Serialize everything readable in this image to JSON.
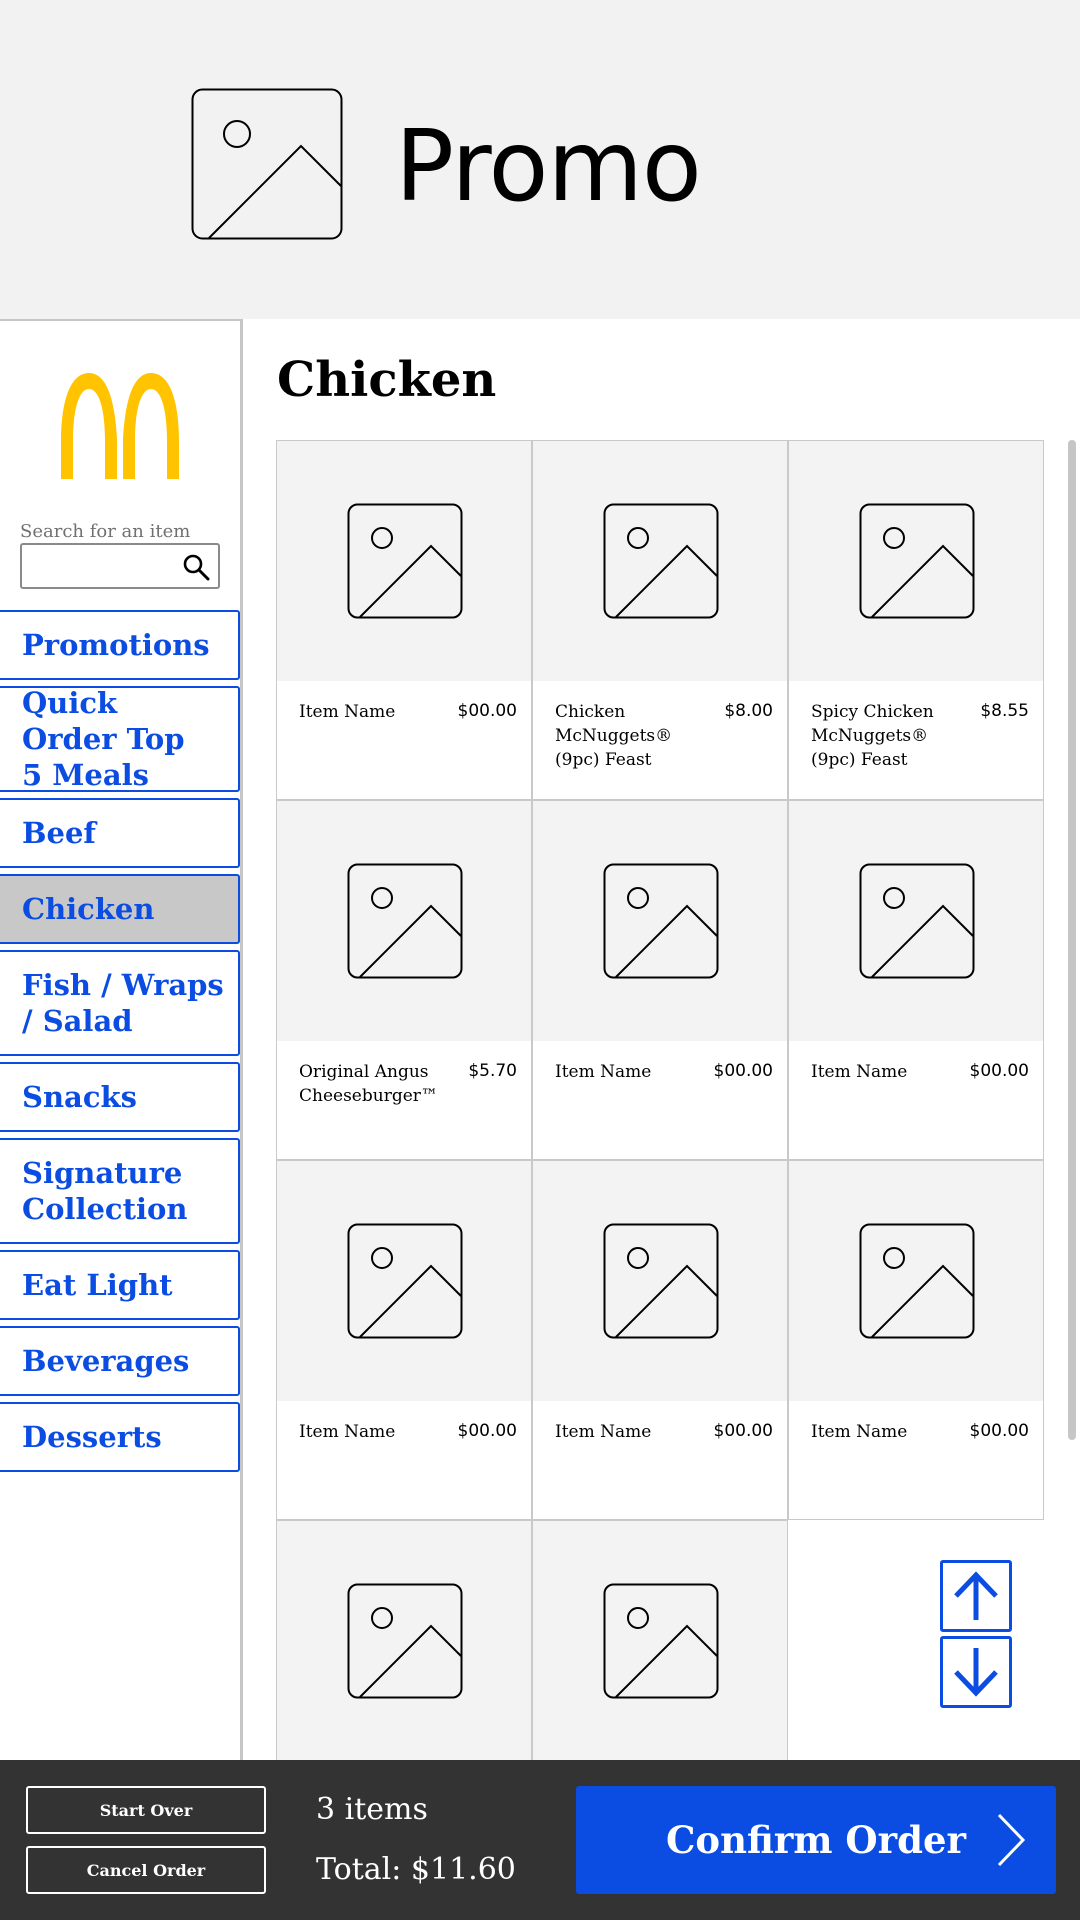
{
  "promo": {
    "title": "Promo",
    "image_icon": "image-placeholder-icon"
  },
  "sidebar": {
    "logo_icon": "mcdonalds-arches-logo",
    "search": {
      "label": "Search for an item",
      "placeholder": "",
      "value": "",
      "icon": "search-icon"
    },
    "categories": [
      {
        "label": "Promotions",
        "active": false
      },
      {
        "label": "Quick Order Top 5 Meals",
        "active": false
      },
      {
        "label": "Beef",
        "active": false
      },
      {
        "label": "Chicken",
        "active": true
      },
      {
        "label": "Fish / Wraps / Salad",
        "active": false
      },
      {
        "label": "Snacks",
        "active": false
      },
      {
        "label": "Signature Collection",
        "active": false
      },
      {
        "label": "Eat Light",
        "active": false
      },
      {
        "label": "Beverages",
        "active": false
      },
      {
        "label": "Desserts",
        "active": false
      }
    ]
  },
  "main": {
    "section_title": "Chicken",
    "items": [
      {
        "name": "Item Name",
        "price": "$00.00"
      },
      {
        "name": "Chicken McNuggets® (9pc) Feast",
        "price": "$8.00"
      },
      {
        "name": "Spicy Chicken McNuggets® (9pc) Feast",
        "price": "$8.55"
      },
      {
        "name": "Original Angus Cheeseburger™",
        "price": "$5.70"
      },
      {
        "name": "Item Name",
        "price": "$00.00"
      },
      {
        "name": "Item Name",
        "price": "$00.00"
      },
      {
        "name": "Item Name",
        "price": "$00.00"
      },
      {
        "name": "Item Name",
        "price": "$00.00"
      },
      {
        "name": "Item Name",
        "price": "$00.00"
      },
      {
        "name": "",
        "price": ""
      },
      {
        "name": "",
        "price": ""
      }
    ],
    "scroll_up_icon": "arrow-up-icon",
    "scroll_down_icon": "arrow-down-icon"
  },
  "footer": {
    "start_over": "Start Over",
    "cancel_order": "Cancel Order",
    "items_count": "3 items",
    "total": "Total: $11.60",
    "confirm": "Confirm Order",
    "confirm_icon": "chevron-right-icon"
  },
  "colors": {
    "accent": "#0b4de2",
    "footer_bg": "#333333",
    "promo_bg": "#f2f2f2",
    "logo": "#ffc300",
    "active_bg": "#c8c8c8"
  }
}
